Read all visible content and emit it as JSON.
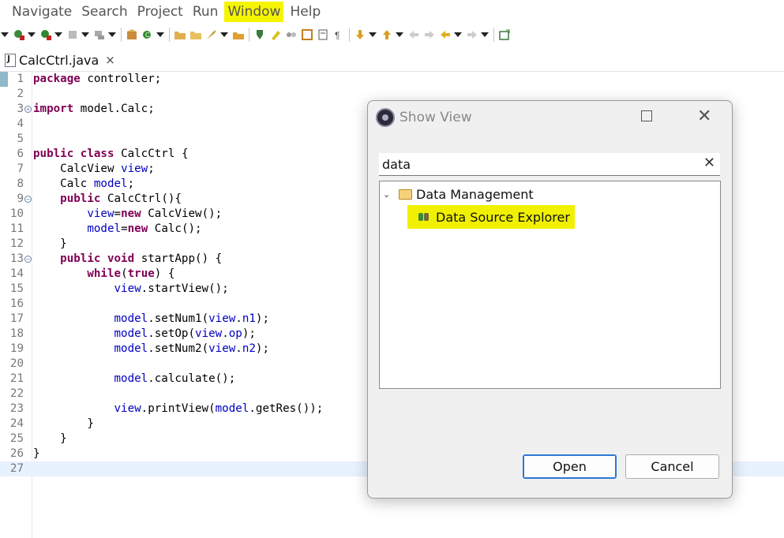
{
  "menubar": {
    "items": [
      {
        "label": "Navigate"
      },
      {
        "label": "Search"
      },
      {
        "label": "Project"
      },
      {
        "label": "Run"
      },
      {
        "label": "Window",
        "highlighted": true
      },
      {
        "label": "Help"
      }
    ]
  },
  "editor": {
    "tab": {
      "label": "CalcCtrl.java",
      "close": "×"
    },
    "current_line": 27,
    "lines": [
      {
        "n": "1",
        "code": "package controller;"
      },
      {
        "n": "2",
        "code": ""
      },
      {
        "n": "3",
        "code": "import model.Calc;"
      },
      {
        "n": "4",
        "code": ""
      },
      {
        "n": "5",
        "code": ""
      },
      {
        "n": "6",
        "code": "public class CalcCtrl {"
      },
      {
        "n": "7",
        "code": "    CalcView view;"
      },
      {
        "n": "8",
        "code": "    Calc model;"
      },
      {
        "n": "9",
        "code": "    public CalcCtrl(){"
      },
      {
        "n": "10",
        "code": "        view=new CalcView();"
      },
      {
        "n": "11",
        "code": "        model=new Calc();"
      },
      {
        "n": "12",
        "code": "    }"
      },
      {
        "n": "13",
        "code": "    public void startApp() {"
      },
      {
        "n": "14",
        "code": "        while(true) {"
      },
      {
        "n": "15",
        "code": "            view.startView();"
      },
      {
        "n": "16",
        "code": ""
      },
      {
        "n": "17",
        "code": "            model.setNum1(view.n1);"
      },
      {
        "n": "18",
        "code": "            model.setOp(view.op);"
      },
      {
        "n": "19",
        "code": "            model.setNum2(view.n2);"
      },
      {
        "n": "20",
        "code": ""
      },
      {
        "n": "21",
        "code": "            model.calculate();"
      },
      {
        "n": "22",
        "code": ""
      },
      {
        "n": "23",
        "code": "            view.printView(model.getRes());"
      },
      {
        "n": "24",
        "code": "        }"
      },
      {
        "n": "25",
        "code": "    }"
      },
      {
        "n": "26",
        "code": "}"
      },
      {
        "n": "27",
        "code": ""
      }
    ]
  },
  "dialog": {
    "title": "Show View",
    "filter": {
      "value": "data",
      "clear": "✕"
    },
    "tree": {
      "category": "Data Management",
      "item": "Data Source Explorer"
    },
    "buttons": {
      "open": "Open",
      "cancel": "Cancel"
    },
    "max_icon": "maximize-icon",
    "close_glyph": "✕"
  },
  "colors": {
    "highlight": "#f0f000",
    "keyword": "#7f0055",
    "field": "#0000c0"
  }
}
